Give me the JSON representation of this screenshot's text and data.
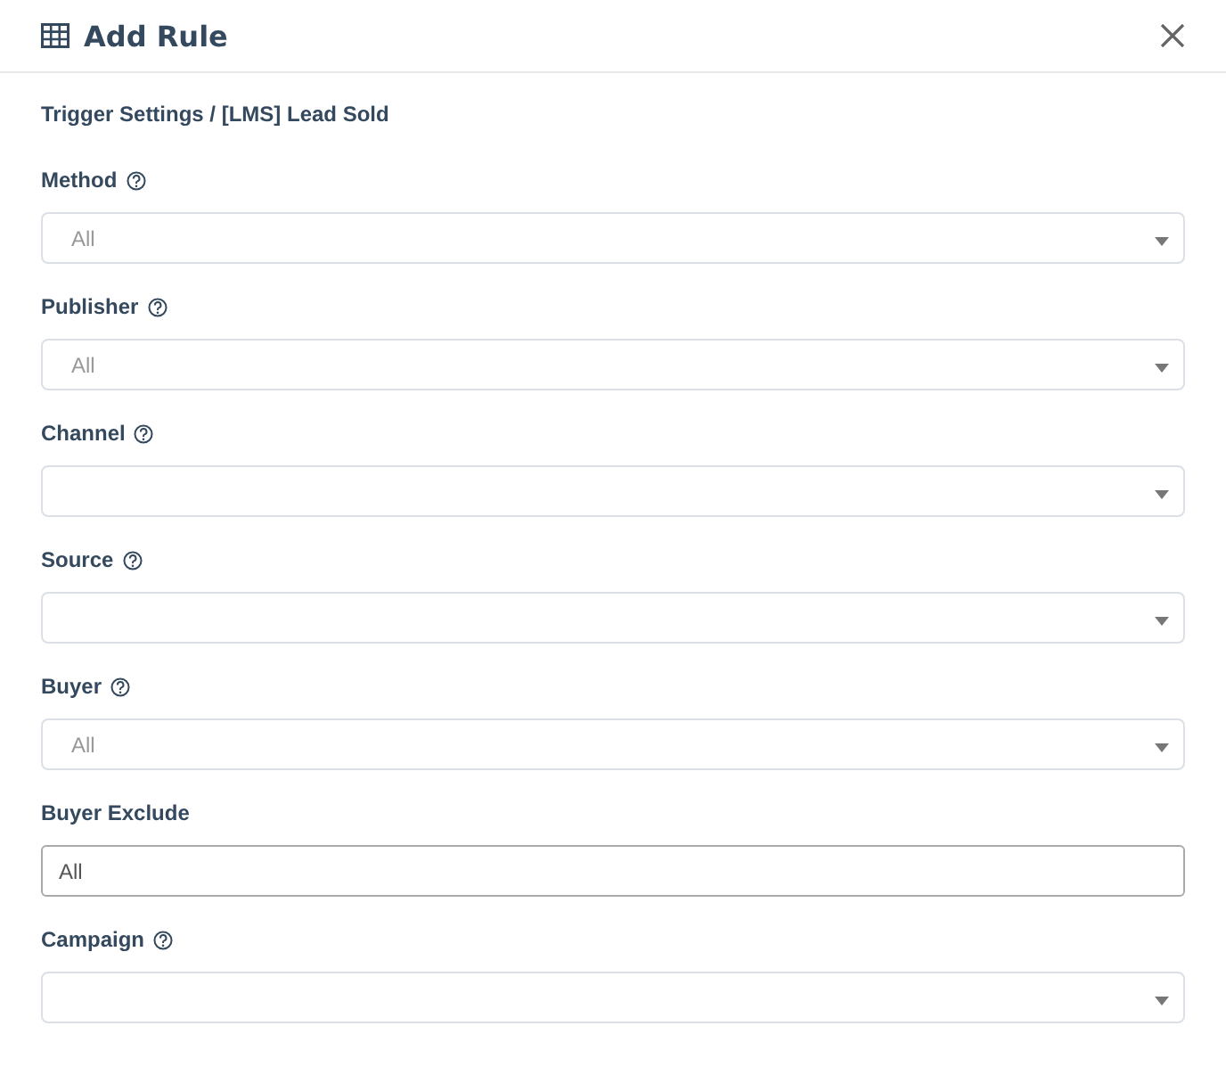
{
  "dialog": {
    "title": "Add Rule"
  },
  "breadcrumb": "Trigger Settings / [LMS] Lead Sold",
  "fields": [
    {
      "label": "Method",
      "help": true,
      "kind": "select",
      "placeholder": "All"
    },
    {
      "label": "Publisher",
      "help": true,
      "kind": "select",
      "placeholder": "All"
    },
    {
      "label": "Channel",
      "help": true,
      "kind": "select"
    },
    {
      "label": "Source",
      "help": true,
      "kind": "select"
    },
    {
      "label": "Buyer",
      "help": true,
      "kind": "select",
      "placeholder": "All"
    },
    {
      "label": "Buyer Exclude",
      "help": false,
      "kind": "text",
      "value": "All"
    },
    {
      "label": "Campaign",
      "help": true,
      "kind": "select"
    }
  ]
}
